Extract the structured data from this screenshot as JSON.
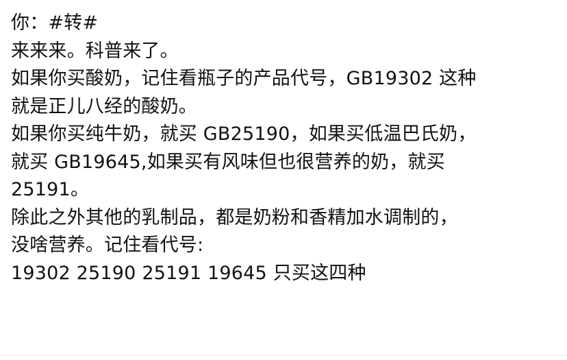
{
  "post": {
    "lines": [
      "你：#转#",
      "来来来。科普来了。",
      "如果你买酸奶，记住看瓶子的产品代号，GB19302 这种",
      "就是正儿八经的酸奶。",
      "如果你买纯牛奶，就买 GB25190，如果买低温巴氏奶，",
      "就买 GB19645,如果买有风味但也很营养的奶，就买",
      "25191。",
      "除此之外其他的乳制品，都是奶粉和香精加水调制的，",
      "没啥营养。记住看代号:",
      "19302  25190  25191 19645 只买这四种"
    ]
  }
}
